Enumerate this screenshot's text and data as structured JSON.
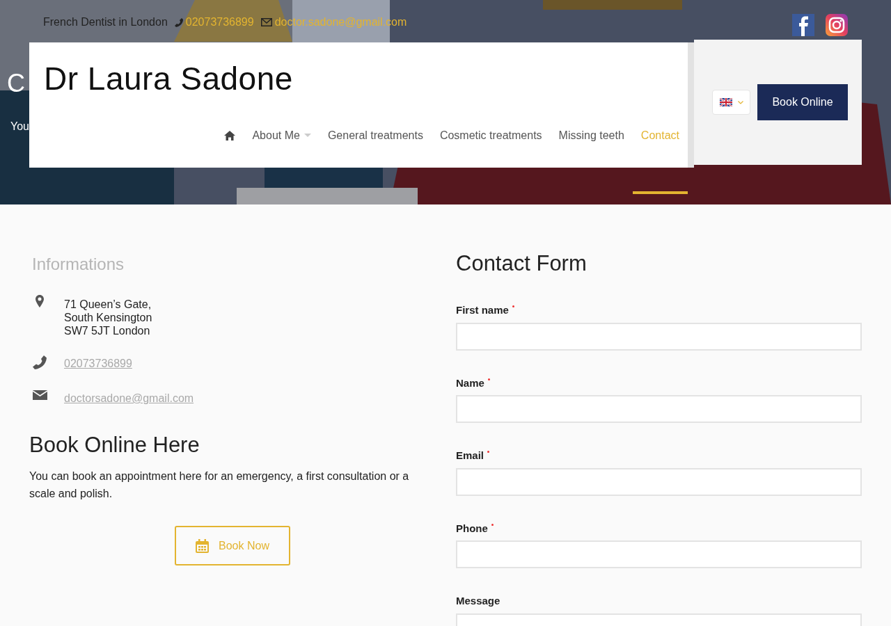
{
  "topbar": {
    "tagline": "French Dentist in London",
    "phone": "02073736899",
    "email": "doctor.sadone@gmail.com"
  },
  "social": [
    {
      "kind": "facebook"
    },
    {
      "kind": "instagram"
    }
  ],
  "hero": {
    "title": "C",
    "subtitle": "You"
  },
  "header": {
    "logo": "Dr Laura Sadone",
    "nav": [
      {
        "kind": "home",
        "selected": false
      },
      {
        "kind": "link",
        "label": "About Me",
        "dropdown": true,
        "selected": false
      },
      {
        "kind": "link",
        "label": "General treatments",
        "dropdown": false,
        "selected": false
      },
      {
        "kind": "link",
        "label": "Cosmetic treatments",
        "dropdown": false,
        "selected": false
      },
      {
        "kind": "link",
        "label": "Missing teeth",
        "dropdown": false,
        "selected": false
      },
      {
        "kind": "link",
        "label": "Contact",
        "dropdown": false,
        "selected": true
      }
    ],
    "language": {
      "kind": "uk"
    },
    "book_button": "Book Online"
  },
  "info": {
    "title": "Informations",
    "address": [
      "71 Queen’s Gate,",
      "South Kensington",
      "SW7 5JT London"
    ],
    "phone": "02073736899",
    "email": "doctorsadone@gmail.com"
  },
  "booking": {
    "title": "Book Online Here",
    "text": "You can book an appointment here for an emergency, a first consultation or a scale and polish.",
    "button": "Book Now"
  },
  "form": {
    "title": "Contact Form",
    "fields": [
      {
        "label": "First name",
        "required": true,
        "kind": "input"
      },
      {
        "label": "Name",
        "required": true,
        "kind": "input"
      },
      {
        "label": "Email",
        "required": true,
        "kind": "input"
      },
      {
        "label": "Phone",
        "required": true,
        "kind": "input"
      },
      {
        "label": "Message",
        "required": false,
        "kind": "textarea"
      }
    ]
  }
}
